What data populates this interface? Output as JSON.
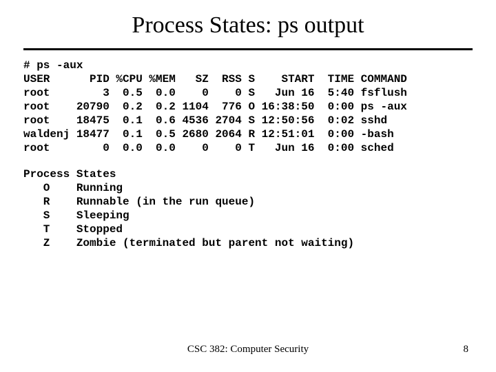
{
  "title": "Process States: ps output",
  "command": "# ps -aux",
  "headers": {
    "user": "USER",
    "pid": "PID",
    "cpu": "%CPU",
    "mem": "%MEM",
    "sz": "SZ",
    "rss": "RSS",
    "s": "S",
    "start": "START",
    "time": "TIME",
    "cmd": "COMMAND"
  },
  "rows": [
    {
      "user": "root",
      "pid": "3",
      "cpu": "0.5",
      "mem": "0.0",
      "sz": "0",
      "rss": "0",
      "s": "S",
      "start": "Jun 16",
      "time": "5:40",
      "cmd": "fsflush"
    },
    {
      "user": "root",
      "pid": "20790",
      "cpu": "0.2",
      "mem": "0.2",
      "sz": "1104",
      "rss": "776",
      "s": "O",
      "start": "16:38:50",
      "time": "0:00",
      "cmd": "ps -aux"
    },
    {
      "user": "root",
      "pid": "18475",
      "cpu": "0.1",
      "mem": "0.6",
      "sz": "4536",
      "rss": "2704",
      "s": "S",
      "start": "12:50:56",
      "time": "0:02",
      "cmd": "sshd"
    },
    {
      "user": "waldenj",
      "pid": "18477",
      "cpu": "0.1",
      "mem": "0.5",
      "sz": "2680",
      "rss": "2064",
      "s": "R",
      "start": "12:51:01",
      "time": "0:00",
      "cmd": "-bash"
    },
    {
      "user": "root",
      "pid": "0",
      "cpu": "0.0",
      "mem": "0.0",
      "sz": "0",
      "rss": "0",
      "s": "T",
      "start": "Jun 16",
      "time": "0:00",
      "cmd": "sched"
    }
  ],
  "states_title": "Process States",
  "states": [
    {
      "code": "O",
      "desc": "Running"
    },
    {
      "code": "R",
      "desc": "Runnable (in the run queue)"
    },
    {
      "code": "S",
      "desc": "Sleeping"
    },
    {
      "code": "T",
      "desc": "Stopped"
    },
    {
      "code": "Z",
      "desc": "Zombie (terminated but parent not waiting)"
    }
  ],
  "footer": {
    "course": "CSC 382: Computer Security",
    "page": "8"
  }
}
